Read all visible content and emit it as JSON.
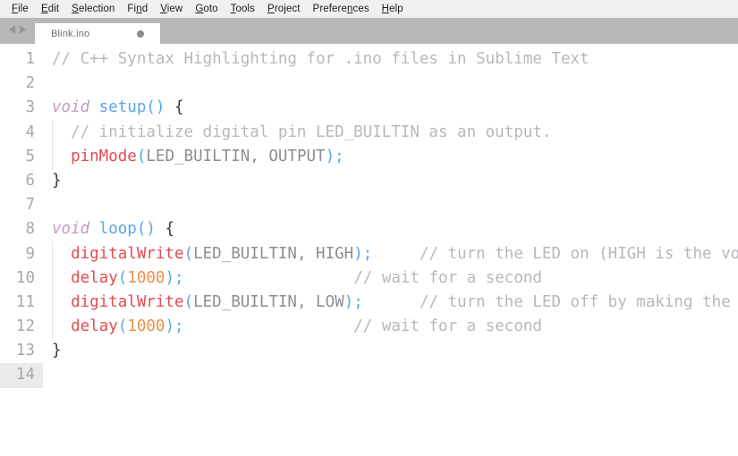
{
  "menubar": {
    "items": [
      {
        "label": "File",
        "mnemonic_index": 0
      },
      {
        "label": "Edit",
        "mnemonic_index": 0
      },
      {
        "label": "Selection",
        "mnemonic_index": 0
      },
      {
        "label": "Find",
        "mnemonic_index": 2
      },
      {
        "label": "View",
        "mnemonic_index": 0
      },
      {
        "label": "Goto",
        "mnemonic_index": 0
      },
      {
        "label": "Tools",
        "mnemonic_index": 0
      },
      {
        "label": "Project",
        "mnemonic_index": 0
      },
      {
        "label": "Preferences",
        "mnemonic_index": 7
      },
      {
        "label": "Help",
        "mnemonic_index": 0
      }
    ]
  },
  "tabbar": {
    "nav_prev_icon": "chevron-left-icon",
    "nav_next_icon": "chevron-right-icon",
    "active_tab": {
      "label": "Blink.ino",
      "dirty_icon": "unsaved-dot-icon",
      "dirty": true
    },
    "background_color": "#b7b7b7"
  },
  "editor": {
    "current_line": 14,
    "colors": {
      "background": "#ffffff",
      "gutter_text": "#a8a8a8",
      "current_line_gutter": "#ebebeb",
      "comment": "#b6b8bd",
      "storage_type": "#c49ac4",
      "entity_name": "#5aa6e8",
      "function_call": "#e04d52",
      "constant": "#8b8e93",
      "number": "#ef8f4b",
      "punctuation": "#333740"
    },
    "lines": [
      {
        "n": 1,
        "indent": false,
        "tokens": [
          {
            "t": "// C++ Syntax Highlighting for .ino files in Sublime Text",
            "c": "c-comment"
          }
        ]
      },
      {
        "n": 2,
        "indent": false,
        "tokens": []
      },
      {
        "n": 3,
        "indent": false,
        "tokens": [
          {
            "t": "void",
            "c": "c-storage"
          },
          {
            "t": " ",
            "c": "c-plain"
          },
          {
            "t": "setup",
            "c": "c-entity"
          },
          {
            "t": "()",
            "c": "c-punct"
          },
          {
            "t": " ",
            "c": "c-plain"
          },
          {
            "t": "{",
            "c": "c-brace"
          }
        ]
      },
      {
        "n": 4,
        "indent": true,
        "tokens": [
          {
            "t": "  // initialize digital pin LED_BUILTIN as an output.",
            "c": "c-comment"
          }
        ]
      },
      {
        "n": 5,
        "indent": true,
        "tokens": [
          {
            "t": "  ",
            "c": "c-plain"
          },
          {
            "t": "pinMode",
            "c": "c-func"
          },
          {
            "t": "(",
            "c": "c-punct"
          },
          {
            "t": "LED_BUILTIN, OUTPUT",
            "c": "c-const"
          },
          {
            "t": ")",
            "c": "c-punct"
          },
          {
            "t": ";",
            "c": "c-punct"
          }
        ]
      },
      {
        "n": 6,
        "indent": false,
        "tokens": [
          {
            "t": "}",
            "c": "c-brace"
          }
        ]
      },
      {
        "n": 7,
        "indent": false,
        "tokens": []
      },
      {
        "n": 8,
        "indent": false,
        "tokens": [
          {
            "t": "void",
            "c": "c-storage"
          },
          {
            "t": " ",
            "c": "c-plain"
          },
          {
            "t": "loop",
            "c": "c-entity"
          },
          {
            "t": "()",
            "c": "c-punct"
          },
          {
            "t": " ",
            "c": "c-plain"
          },
          {
            "t": "{",
            "c": "c-brace"
          }
        ]
      },
      {
        "n": 9,
        "indent": true,
        "tokens": [
          {
            "t": "  ",
            "c": "c-plain"
          },
          {
            "t": "digitalWrite",
            "c": "c-func"
          },
          {
            "t": "(",
            "c": "c-punct"
          },
          {
            "t": "LED_BUILTIN, HIGH",
            "c": "c-const"
          },
          {
            "t": ")",
            "c": "c-punct"
          },
          {
            "t": ";",
            "c": "c-punct"
          },
          {
            "t": "   ",
            "c": "c-plain"
          },
          {
            "t": "  // turn the LED on (HIGH is the voltage level)",
            "c": "c-comment"
          }
        ]
      },
      {
        "n": 10,
        "indent": true,
        "tokens": [
          {
            "t": "  ",
            "c": "c-plain"
          },
          {
            "t": "delay",
            "c": "c-func"
          },
          {
            "t": "(",
            "c": "c-punct"
          },
          {
            "t": "1000",
            "c": "c-number"
          },
          {
            "t": ")",
            "c": "c-punct"
          },
          {
            "t": ";",
            "c": "c-punct"
          },
          {
            "t": "                  ",
            "c": "c-plain"
          },
          {
            "t": "// wait for a second",
            "c": "c-comment"
          }
        ]
      },
      {
        "n": 11,
        "indent": true,
        "tokens": [
          {
            "t": "  ",
            "c": "c-plain"
          },
          {
            "t": "digitalWrite",
            "c": "c-func"
          },
          {
            "t": "(",
            "c": "c-punct"
          },
          {
            "t": "LED_BUILTIN, LOW",
            "c": "c-const"
          },
          {
            "t": ")",
            "c": "c-punct"
          },
          {
            "t": ";",
            "c": "c-punct"
          },
          {
            "t": "    ",
            "c": "c-plain"
          },
          {
            "t": "  // turn the LED off by making the voltage LOW",
            "c": "c-comment"
          }
        ]
      },
      {
        "n": 12,
        "indent": true,
        "tokens": [
          {
            "t": "  ",
            "c": "c-plain"
          },
          {
            "t": "delay",
            "c": "c-func"
          },
          {
            "t": "(",
            "c": "c-punct"
          },
          {
            "t": "1000",
            "c": "c-number"
          },
          {
            "t": ")",
            "c": "c-punct"
          },
          {
            "t": ";",
            "c": "c-punct"
          },
          {
            "t": "                  ",
            "c": "c-plain"
          },
          {
            "t": "// wait for a second",
            "c": "c-comment"
          }
        ]
      },
      {
        "n": 13,
        "indent": false,
        "tokens": [
          {
            "t": "}",
            "c": "c-brace"
          }
        ]
      },
      {
        "n": 14,
        "indent": false,
        "tokens": []
      }
    ]
  }
}
